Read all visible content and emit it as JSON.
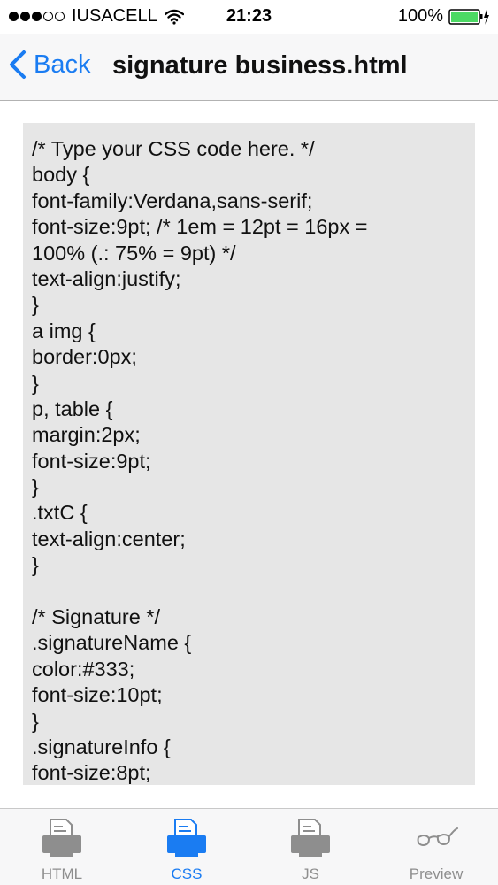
{
  "status_bar": {
    "carrier": "IUSACELL",
    "time": "21:23",
    "battery": "100%",
    "signal_bars": 3,
    "signal_total": 5
  },
  "nav": {
    "back_label": "Back",
    "title": "signature business.html"
  },
  "editor": {
    "lines": [
      "/* Type your CSS code here. */",
      "body {",
      "font-family:Verdana,sans-serif;",
      "font-size:9pt; /* 1em = 12pt = 16px =",
      "100% (.: 75% = 9pt) */",
      "text-align:justify;",
      "}",
      "a img {",
      "border:0px;",
      "}",
      "p, table {",
      "margin:2px;",
      "font-size:9pt;",
      "}",
      ".txtC {",
      "text-align:center;",
      "}",
      "",
      "/* Signature */",
      ".signatureName {",
      "color:#333;",
      "font-size:10pt;",
      "}",
      ".signatureInfo {",
      "font-size:8pt;"
    ]
  },
  "tabs": [
    {
      "label": "HTML",
      "icon": "printer-icon",
      "active": false
    },
    {
      "label": "CSS",
      "icon": "printer-icon",
      "active": true
    },
    {
      "label": "JS",
      "icon": "printer-icon",
      "active": false
    },
    {
      "label": "Preview",
      "icon": "glasses-icon",
      "active": false
    }
  ],
  "colors": {
    "accent": "#1a7cf2",
    "battery": "#4cd964",
    "editor_bg": "#e6e6e6",
    "tab_inactive": "#8e8e8e"
  }
}
